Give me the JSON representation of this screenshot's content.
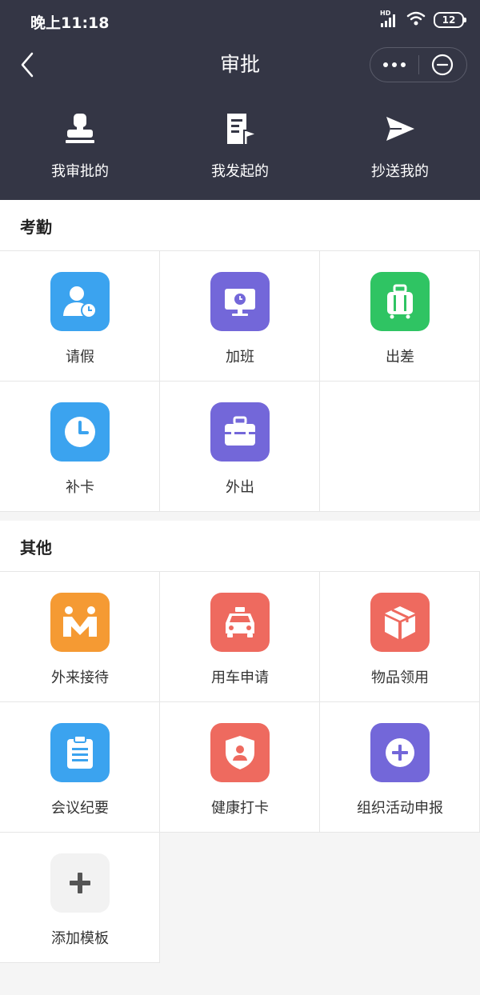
{
  "status_bar": {
    "time": "晚上11:18",
    "network": "HD",
    "battery": "12"
  },
  "nav": {
    "title": "审批"
  },
  "top_tabs": [
    {
      "label": "我审批的",
      "icon": "approver-stamp-icon"
    },
    {
      "label": "我发起的",
      "icon": "document-flag-icon"
    },
    {
      "label": "抄送我的",
      "icon": "send-plane-icon"
    }
  ],
  "sections": [
    {
      "title": "考勤",
      "items": [
        {
          "label": "请假",
          "icon": "person-clock-icon",
          "color": "#3ba3ef"
        },
        {
          "label": "加班",
          "icon": "monitor-clock-icon",
          "color": "#7367d9"
        },
        {
          "label": "出差",
          "icon": "suitcase-icon",
          "color": "#2fc463"
        },
        {
          "label": "补卡",
          "icon": "clock-icon",
          "color": "#3ba3ef"
        },
        {
          "label": "外出",
          "icon": "briefcase-icon",
          "color": "#7367d9"
        }
      ]
    },
    {
      "title": "其他",
      "items": [
        {
          "label": "外来接待",
          "icon": "m-logo-icon",
          "color": "#f59a33"
        },
        {
          "label": "用车申请",
          "icon": "taxi-icon",
          "color": "#ee6a5f"
        },
        {
          "label": "物品领用",
          "icon": "box-icon",
          "color": "#ee6a5f"
        },
        {
          "label": "会议纪要",
          "icon": "clipboard-icon",
          "color": "#3ba3ef"
        },
        {
          "label": "健康打卡",
          "icon": "shield-person-icon",
          "color": "#ee6a5f"
        },
        {
          "label": "组织活动申报",
          "icon": "plus-circle-icon",
          "color": "#7367d9"
        },
        {
          "label": "添加模板",
          "icon": "plus-icon",
          "color": "#f2f2f2"
        }
      ]
    }
  ]
}
